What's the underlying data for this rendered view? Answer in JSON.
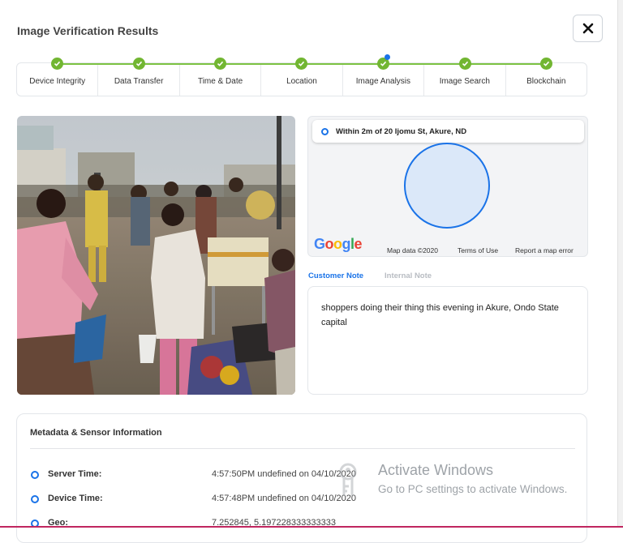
{
  "dialog": {
    "title": "Image Verification Results",
    "close_icon": "close-icon"
  },
  "steps": [
    {
      "label": "Device Integrity",
      "status": "complete"
    },
    {
      "label": "Data Transfer",
      "status": "complete"
    },
    {
      "label": "Time & Date",
      "status": "complete"
    },
    {
      "label": "Location",
      "status": "complete"
    },
    {
      "label": "Image Analysis",
      "status": "active"
    },
    {
      "label": "Image Search",
      "status": "complete"
    },
    {
      "label": "Blockchain",
      "status": "complete"
    }
  ],
  "map": {
    "location_text": "Within 2m of 20 Ijomu St, Akure, ND",
    "logo": "Google",
    "map_data": "Map data ©2020",
    "terms": "Terms of Use",
    "report": "Report a map error"
  },
  "notes": {
    "tabs": [
      {
        "label": "Customer Note",
        "active": true
      },
      {
        "label": "Internal Note",
        "active": false
      }
    ],
    "text": "shoppers doing their thing this evening in Akure, Ondo State capital"
  },
  "metadata": {
    "title": "Metadata & Sensor Information",
    "rows": [
      {
        "label": "Server Time:",
        "value": "4:57:50PM undefined on 04/10/2020"
      },
      {
        "label": "Device Time:",
        "value": "4:57:48PM undefined on 04/10/2020"
      },
      {
        "label": "Geo:",
        "value": "7.252845, 5.197228333333333"
      }
    ]
  },
  "watermark": {
    "title": "Activate Windows",
    "subtitle": "Go to PC settings to activate Windows."
  },
  "colors": {
    "accent": "#1a73e8",
    "success": "#72b632",
    "active_tab": "#1a73e8",
    "inactive_tab": "#b8bcc2"
  }
}
